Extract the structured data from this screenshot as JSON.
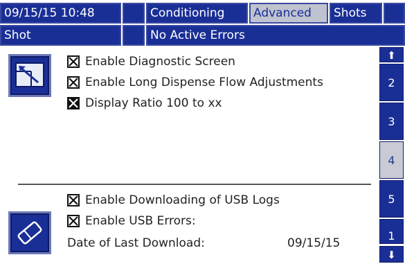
{
  "header": {
    "datetime": "09/15/15 10:48",
    "tabs": [
      {
        "label": "Conditioning",
        "active": false
      },
      {
        "label": "Advanced",
        "active": true
      },
      {
        "label": "Shots",
        "active": false
      }
    ],
    "mode": "Shot",
    "errors": "No Active Errors"
  },
  "screen": {
    "advanced_options": [
      {
        "label": "Enable Diagnostic Screen",
        "checked": true
      },
      {
        "label": "Enable Long Dispense Flow Adjustments",
        "checked": true
      },
      {
        "label": "Display Ratio 100 to xx",
        "checked": true
      }
    ],
    "usb_options": [
      {
        "label": "Enable Downloading of USB Logs",
        "checked": true
      },
      {
        "label": "Enable USB Errors:",
        "checked": true
      }
    ],
    "last_download_label": "Date of Last Download:",
    "last_download_value": "09/15/15"
  },
  "pages": {
    "items": [
      "2",
      "3",
      "4",
      "5",
      "1"
    ],
    "selected": "4"
  },
  "icons": {
    "up": "arrow-up-icon",
    "down": "arrow-down-icon",
    "display": "display-settings-icon",
    "usb": "usb-eraser-icon"
  },
  "colors": {
    "accent": "#1a2f96",
    "tab_active": "#bfc3cf"
  }
}
